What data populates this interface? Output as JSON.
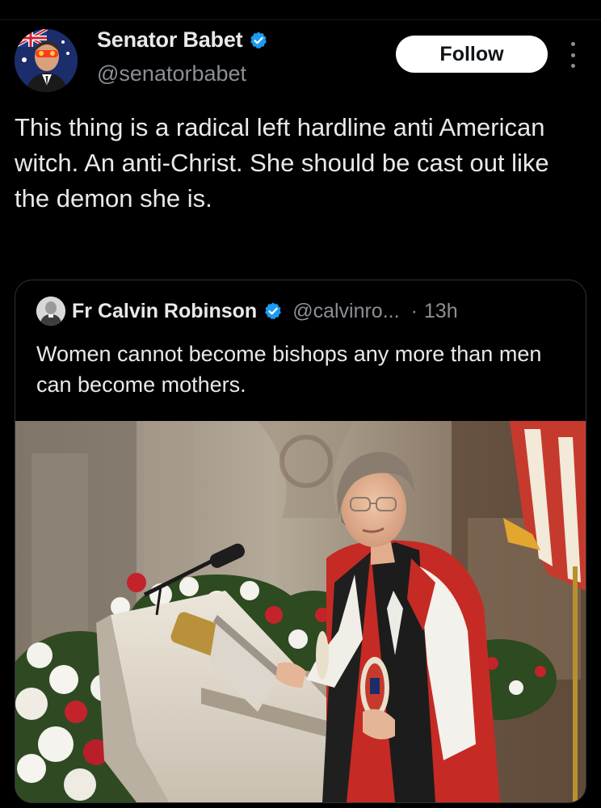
{
  "post": {
    "author": {
      "display_name": "Senator Babet",
      "handle": "@senatorbabet",
      "verified": true
    },
    "follow_label": "Follow",
    "more_icon": "more-vertical-icon",
    "text": "This thing is a radical left hardline anti American witch. An anti-Christ. She should be cast out like the demon she is."
  },
  "quoted_post": {
    "author": {
      "display_name": "Fr Calvin Robinson",
      "handle": "@calvinro...",
      "verified": true
    },
    "separator": "·",
    "time": "13h",
    "text": "Women cannot become bishops any more than men can become mothers.",
    "media_icon": "photo-image"
  },
  "colors": {
    "background": "#000000",
    "text_primary": "#e7e9ea",
    "text_secondary": "#8b8f94",
    "verified_blue": "#1d9bf0",
    "follow_button_bg": "#ffffff",
    "border": "#2f3336"
  }
}
